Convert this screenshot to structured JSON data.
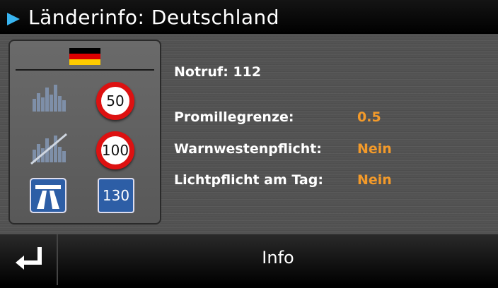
{
  "header": {
    "title": "Länderinfo: Deutschland",
    "icon": "play-arrow-icon",
    "accent": "#38b4f0"
  },
  "signs": {
    "flag_colors": [
      "#000000",
      "#dd0000",
      "#ffcc00"
    ],
    "urban_speed": "50",
    "rural_speed": "100",
    "motorway_speed": "130"
  },
  "info": {
    "notruf": "Notruf: 112",
    "promille_label": "Promillegrenze:",
    "promille_value": "0.5",
    "warnweste_label": "Warnwestenpflicht:",
    "warnweste_value": "Nein",
    "licht_label": "Lichtpflicht am Tag:",
    "licht_value": "Nein",
    "value_color": "#f39a2a"
  },
  "footer": {
    "back_icon": "return-arrow-icon",
    "title": "Info"
  }
}
